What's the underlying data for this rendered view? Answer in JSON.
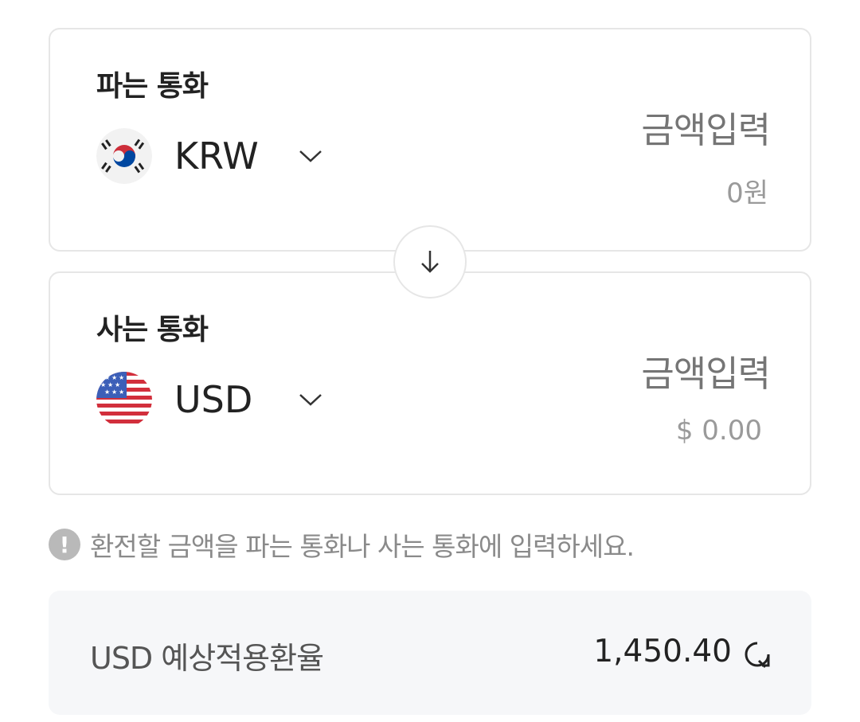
{
  "sell": {
    "title": "파는 통화",
    "currency_code": "KRW",
    "flag_icon": "south-korea-flag-icon",
    "amount_placeholder": "금액입력",
    "converted_amount": "0원"
  },
  "buy": {
    "title": "사는 통화",
    "currency_code": "USD",
    "flag_icon": "usa-flag-icon",
    "amount_placeholder": "금액입력",
    "converted_amount": "$ 0.00"
  },
  "swap": {
    "icon": "arrow-down-icon"
  },
  "notice": {
    "icon_glyph": "!",
    "text": "환전할 금액을 파는 통화나 사는 통화에 입력하세요."
  },
  "rate": {
    "label": "USD 예상적용환율",
    "value": "1,450.40",
    "icon": "refresh-icon"
  },
  "colors": {
    "border": "#e6e6e6",
    "muted_text": "#8a8a8a",
    "panel_bg": "#f6f7f9",
    "korea_red": "#cd2e3a",
    "korea_blue": "#0047a0",
    "usa_red": "#d22f3c",
    "usa_blue": "#3c5fb8"
  }
}
